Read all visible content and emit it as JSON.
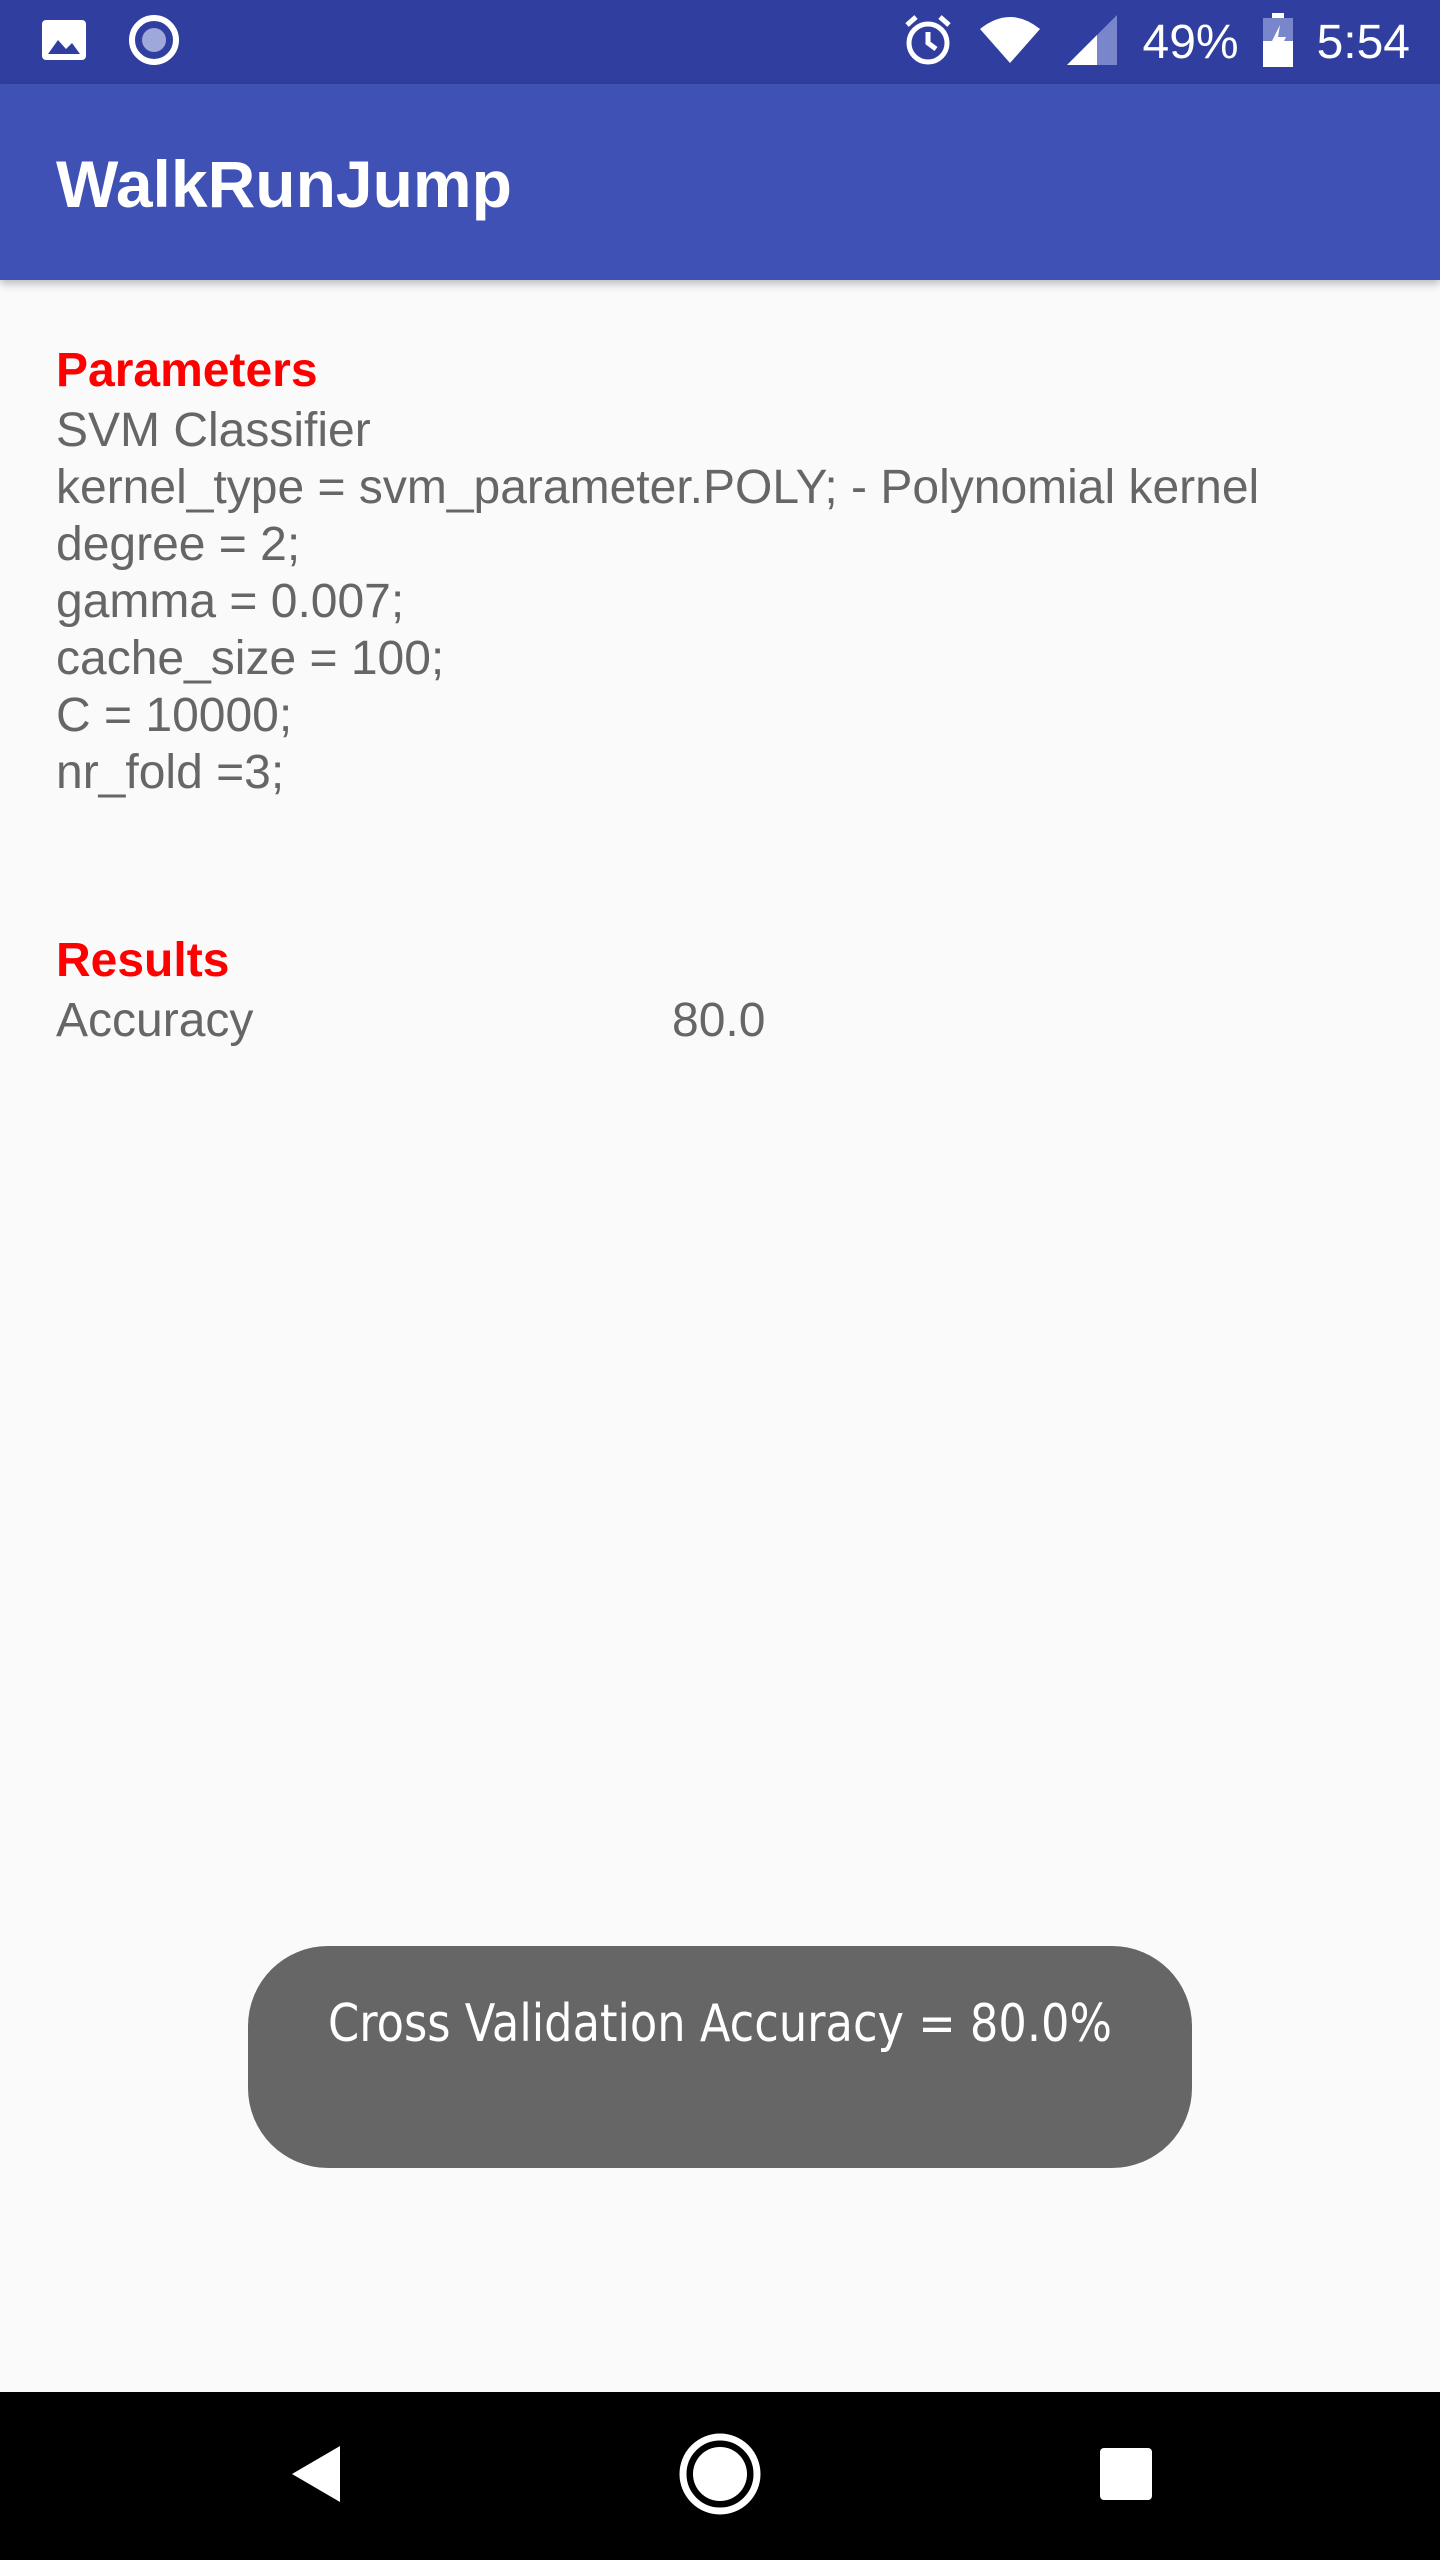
{
  "status_bar": {
    "battery_percent": "49%",
    "time": "5:54",
    "left_icons": [
      "image-icon",
      "record-icon"
    ],
    "right_icons": [
      "alarm-icon",
      "wifi-icon",
      "cell-signal-icon",
      "battery-icon"
    ]
  },
  "app_bar": {
    "title": "WalkRunJump"
  },
  "parameters": {
    "heading": "Parameters",
    "lines": [
      "SVM Classifier",
      "kernel_type = svm_parameter.POLY; - Polynomial kernel",
      "degree = 2;",
      "gamma = 0.007;",
      "cache_size = 100;",
      "C = 10000;",
      "nr_fold =3;"
    ]
  },
  "results": {
    "heading": "Results",
    "rows": [
      {
        "label": "Accuracy",
        "value": "80.0"
      }
    ]
  },
  "toast": {
    "message": "Cross Validation Accuracy = 80.0%"
  },
  "nav_bar": {
    "buttons": [
      "back",
      "home",
      "recents"
    ]
  },
  "colors": {
    "status_bar": "#303F9F",
    "app_bar": "#3F51B5",
    "heading": "#FF0000",
    "body_text": "#666666",
    "toast_bg": "#666666",
    "nav_bar": "#000000"
  }
}
